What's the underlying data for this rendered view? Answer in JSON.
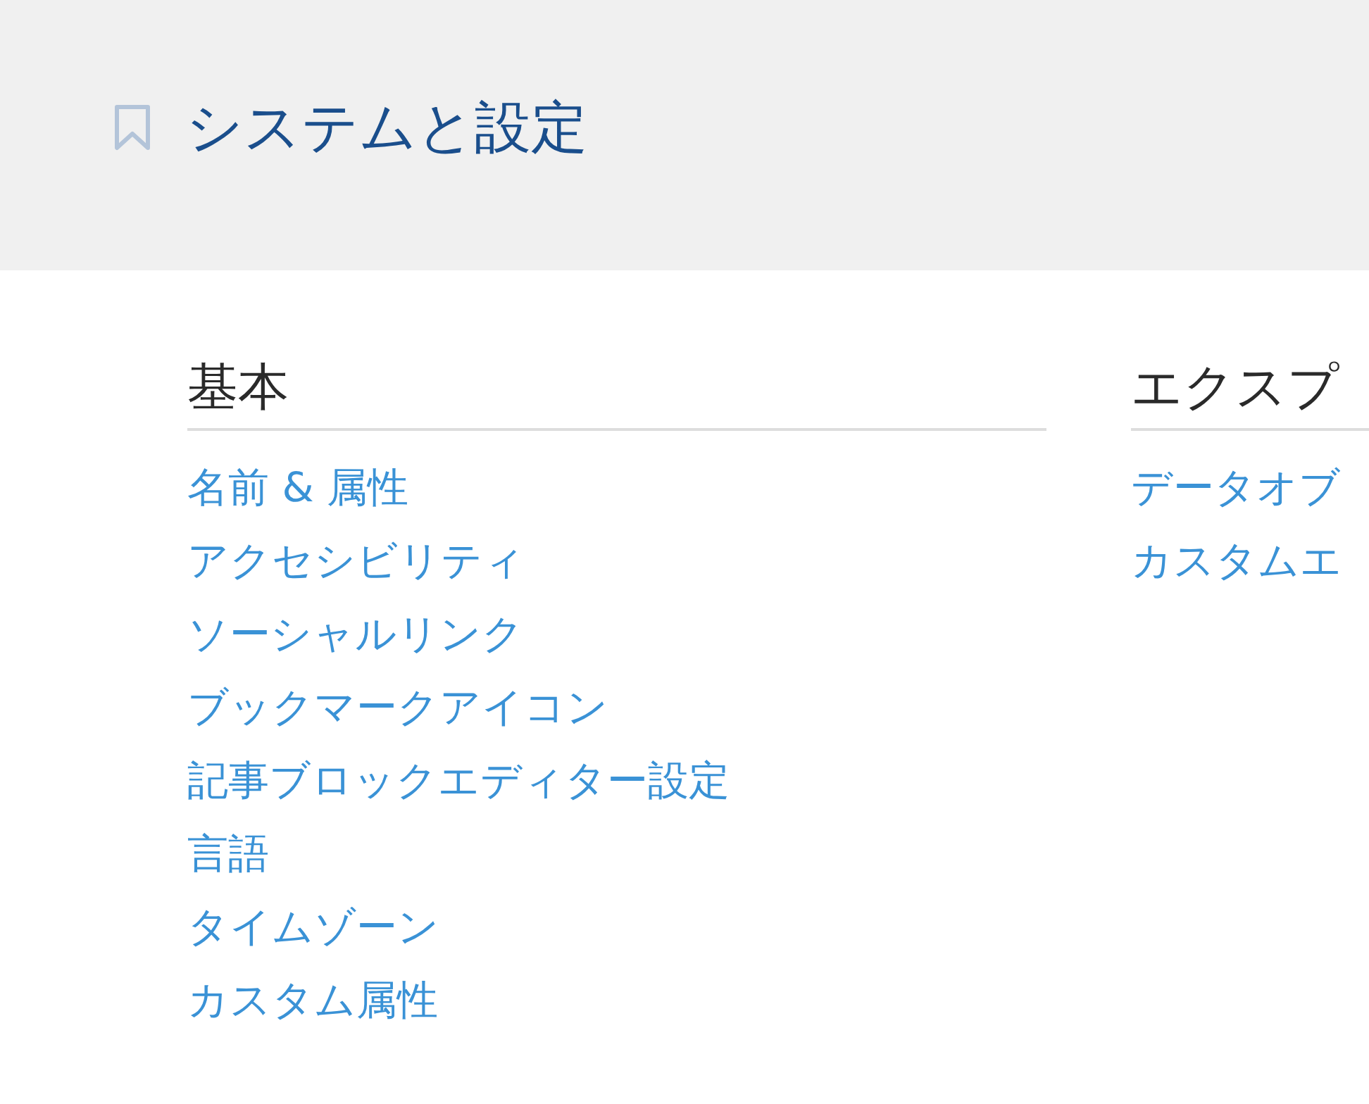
{
  "header": {
    "title": "システムと設定"
  },
  "sections": [
    {
      "heading": "基本",
      "links": [
        "名前 & 属性",
        "アクセシビリティ",
        "ソーシャルリンク",
        "ブックマークアイコン",
        "記事ブロックエディター設定",
        "言語",
        "タイムゾーン",
        "カスタム属性"
      ]
    },
    {
      "heading": "エクスプ",
      "links": [
        "データオブ",
        "カスタムエ"
      ]
    }
  ]
}
